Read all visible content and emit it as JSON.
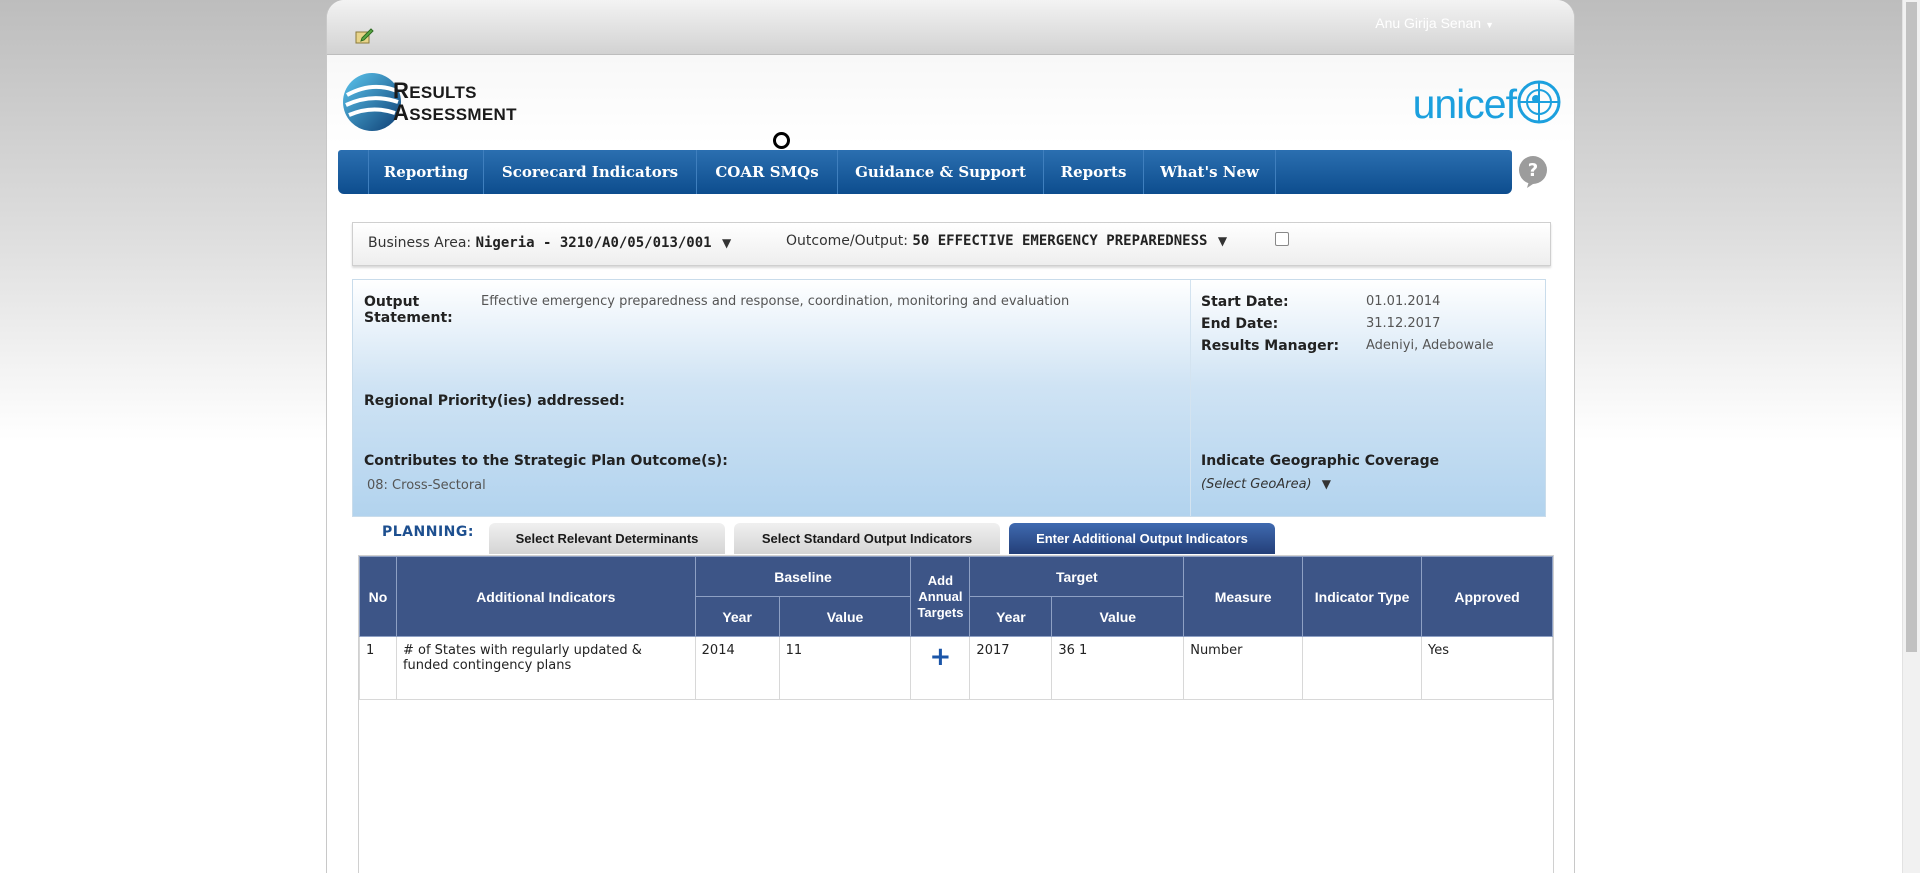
{
  "header": {
    "user_name": "Anu Girija Senan",
    "logo_line1": "Results",
    "logo_line2": "Assessment",
    "brand": "unicef"
  },
  "nav": {
    "items": [
      {
        "label": "Reporting"
      },
      {
        "label": "Scorecard Indicators"
      },
      {
        "label": "COAR SMQs"
      },
      {
        "label": "Guidance & Support"
      },
      {
        "label": "Reports"
      },
      {
        "label": "What's New"
      }
    ]
  },
  "filters": {
    "business_area_label": "Business Area:",
    "business_area_value": "Nigeria - 3210/A0/05/013/001",
    "outcome_label": "Outcome/Output:",
    "outcome_value": "50 EFFECTIVE EMERGENCY PREPAREDNESS"
  },
  "info": {
    "output_statement_label_1": "Output",
    "output_statement_label_2": "Statement:",
    "output_statement": "Effective emergency preparedness and response, coordination, monitoring and evaluation",
    "start_date_label": "Start Date:",
    "start_date": "01.01.2014",
    "end_date_label": "End Date:",
    "end_date": "31.12.2017",
    "results_manager_label": "Results Manager:",
    "results_manager": "Adeniyi, Adebowale",
    "regional_priority_label": "Regional Priority(ies) addressed:",
    "strategic_plan_label": "Contributes to the Strategic Plan Outcome(s):",
    "strategic_plan_value": "08: Cross-Sectoral",
    "geo_coverage_label": "Indicate Geographic Coverage",
    "geo_area_placeholder": "(Select GeoArea)"
  },
  "planning": {
    "label": "PLANNING:",
    "tabs": [
      {
        "label": "Select Relevant Determinants"
      },
      {
        "label": "Select Standard Output Indicators"
      },
      {
        "label": "Enter Additional Output Indicators"
      }
    ]
  },
  "table": {
    "headers": {
      "no": "No",
      "additional_indicators": "Additional Indicators",
      "baseline": "Baseline",
      "add_annual_1": "Add",
      "add_annual_2": "Annual",
      "add_annual_3": "Targets",
      "target": "Target",
      "measure": "Measure",
      "indicator_type": "Indicator Type",
      "approved": "Approved",
      "year": "Year",
      "value": "Value"
    },
    "rows": [
      {
        "no": "1",
        "indicator": "# of States with regularly updated & funded contingency plans",
        "baseline_year": "2014",
        "baseline_value": "11",
        "add_symbol": "+",
        "target_year": "2017",
        "target_value": "36 1",
        "measure": "Number",
        "indicator_type": "",
        "approved": "Yes"
      }
    ]
  }
}
